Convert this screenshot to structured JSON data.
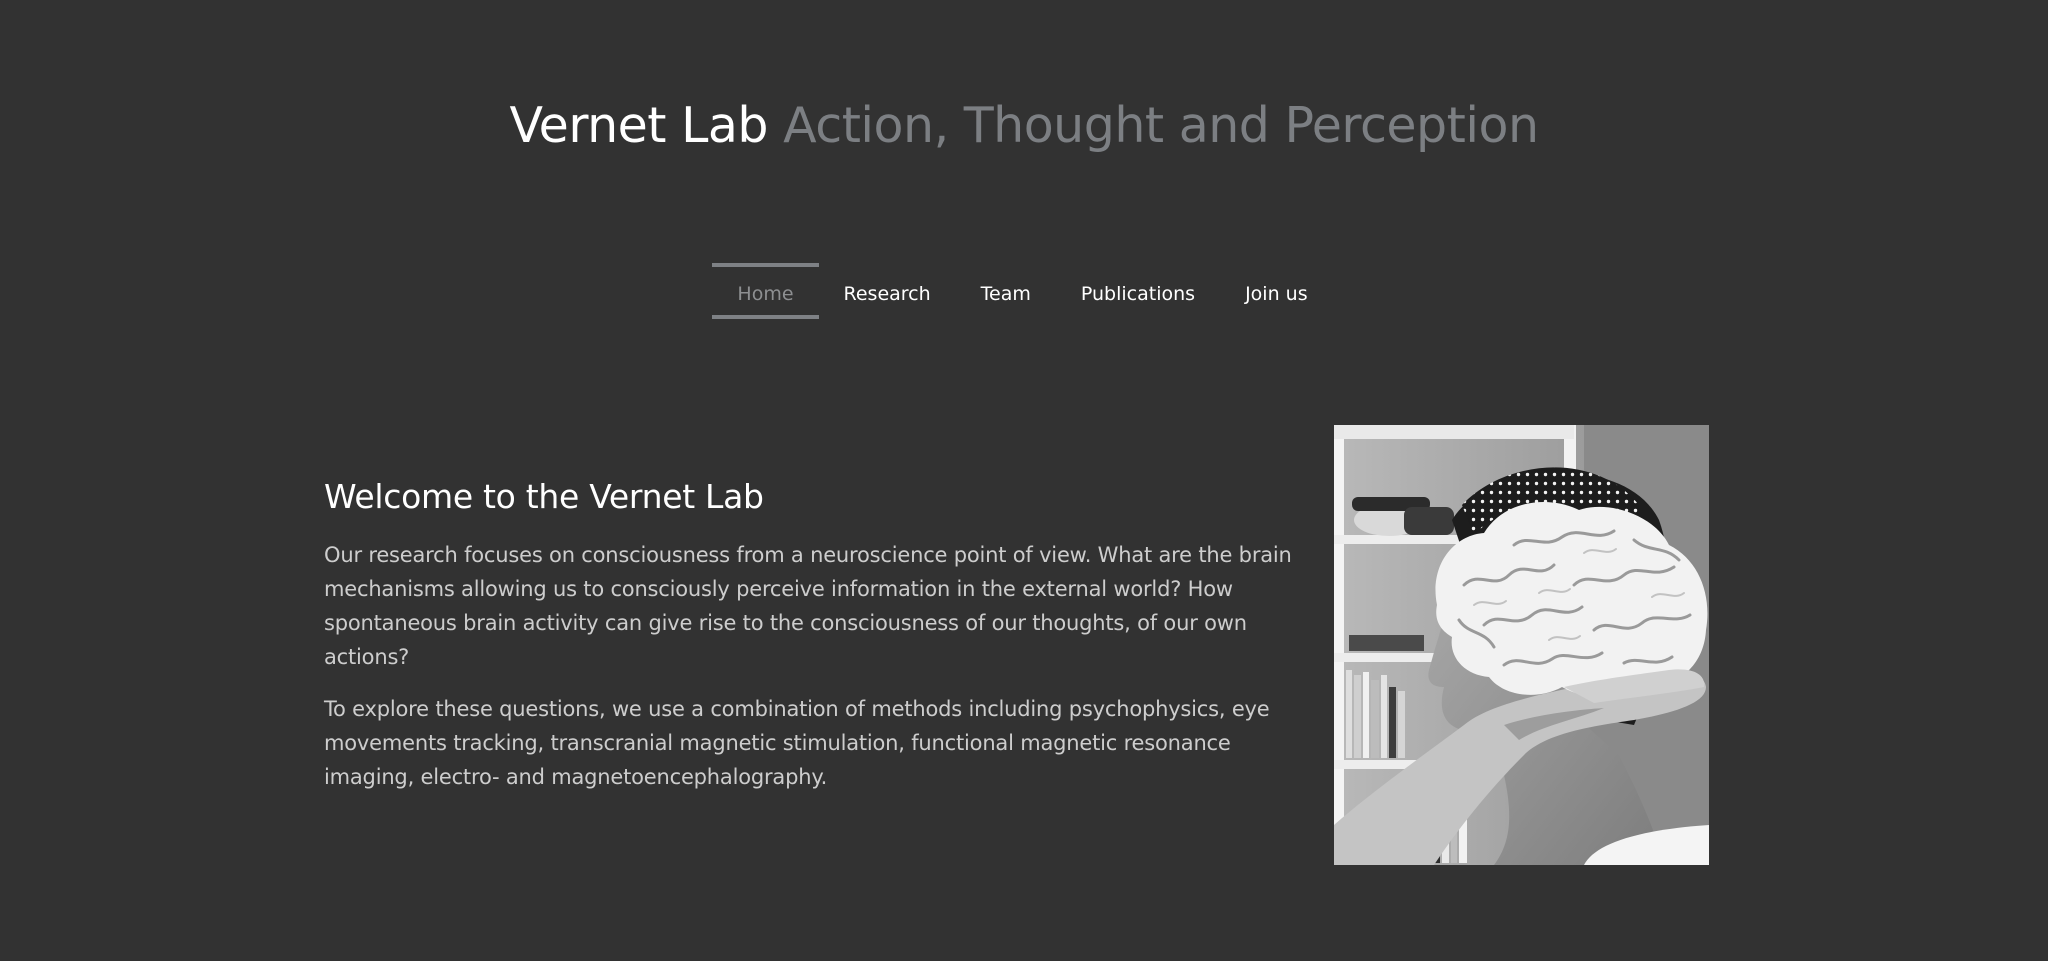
{
  "header": {
    "site_name": "Vernet Lab",
    "tagline": "Action, Thought and Perception"
  },
  "nav": {
    "items": [
      {
        "label": "Home",
        "active": true
      },
      {
        "label": "Research",
        "active": false
      },
      {
        "label": "Team",
        "active": false
      },
      {
        "label": "Publications",
        "active": false
      },
      {
        "label": "Join us",
        "active": false
      }
    ]
  },
  "intro": {
    "title": "Welcome to the Vernet Lab",
    "paragraphs": [
      "Our research focuses on consciousness from a neuroscience point of view. What are the brain mechanisms allowing us to consciously perceive information in the external world? How spontaneous brain activity can give rise to the consciousness of our thoughts, of our own actions?",
      "To explore these questions, we use a combination of methods including psychophysics, eye movements tracking, transcranial magnetic stimulation, functional magnetic resonance imaging, electro- and magnetoencephalography."
    ]
  },
  "photo": {
    "subject": "person-holding-brain-model-photo"
  },
  "colors": {
    "background": "#323232",
    "site_name": "#ffffff",
    "tagline": "#7c7f83",
    "nav_active": "#8d8f91",
    "body_text": "#cdcdcd"
  }
}
